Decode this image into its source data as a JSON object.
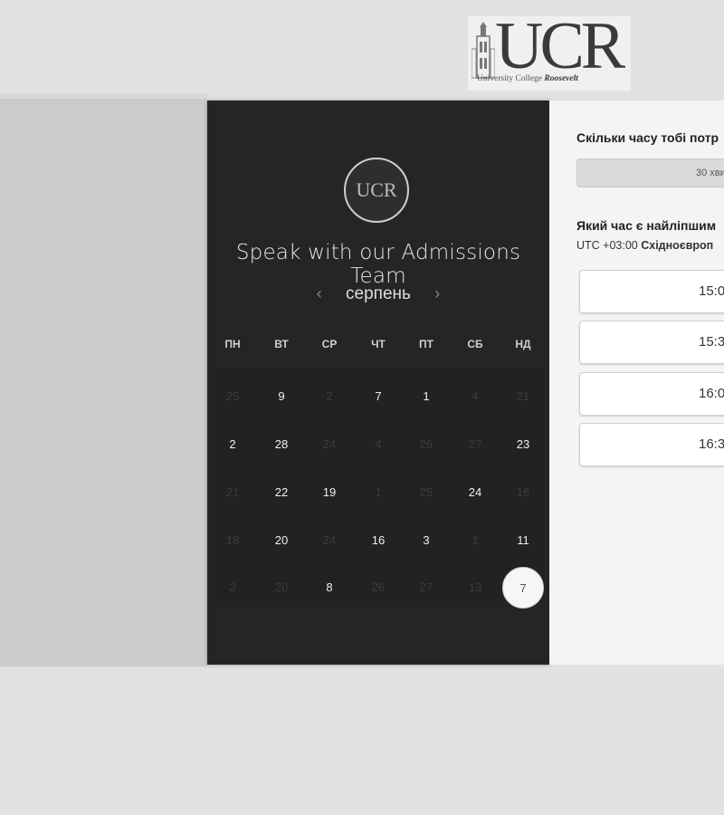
{
  "logo": {
    "letters": "UCR",
    "subtitle_prefix": "University College ",
    "subtitle_name": "Roosevelt"
  },
  "calendar": {
    "badge_text": "UCR",
    "title": "Speak with our Admissions Team",
    "month": "серпень",
    "prev_icon": "‹",
    "next_icon": "›",
    "weekdays": [
      "ПН",
      "ВТ",
      "СР",
      "ЧТ",
      "ПТ",
      "СБ",
      "НД"
    ],
    "weeks": [
      [
        {
          "d": "25",
          "a": false
        },
        {
          "d": "9",
          "a": true
        },
        {
          "d": "2",
          "a": false
        },
        {
          "d": "7",
          "a": true
        },
        {
          "d": "1",
          "a": true
        },
        {
          "d": "4",
          "a": false
        },
        {
          "d": "21",
          "a": false
        }
      ],
      [
        {
          "d": "2",
          "a": true
        },
        {
          "d": "28",
          "a": true
        },
        {
          "d": "24",
          "a": false
        },
        {
          "d": "4",
          "a": false
        },
        {
          "d": "26",
          "a": false
        },
        {
          "d": "27",
          "a": false
        },
        {
          "d": "23",
          "a": true
        }
      ],
      [
        {
          "d": "21",
          "a": false
        },
        {
          "d": "22",
          "a": true
        },
        {
          "d": "19",
          "a": true
        },
        {
          "d": "1",
          "a": false
        },
        {
          "d": "25",
          "a": false
        },
        {
          "d": "24",
          "a": true
        },
        {
          "d": "16",
          "a": false
        }
      ],
      [
        {
          "d": "18",
          "a": false
        },
        {
          "d": "20",
          "a": true
        },
        {
          "d": "24",
          "a": false
        },
        {
          "d": "16",
          "a": true
        },
        {
          "d": "3",
          "a": true
        },
        {
          "d": "1",
          "a": false
        },
        {
          "d": "11",
          "a": true
        }
      ],
      [
        {
          "d": "2",
          "a": false
        },
        {
          "d": "20",
          "a": false
        },
        {
          "d": "8",
          "a": true
        },
        {
          "d": "26",
          "a": false
        },
        {
          "d": "27",
          "a": false
        },
        {
          "d": "13",
          "a": false
        },
        {
          "d": "7",
          "a": true,
          "selected": true
        }
      ]
    ]
  },
  "form": {
    "duration_question": "Скільки часу тобі потр",
    "duration_value": "30 хви",
    "time_question": "Який час є найліпшим",
    "timezone_offset": "UTC +03:00",
    "timezone_name": "Східноєвроп",
    "slots": [
      "15:0",
      "15:3",
      "16:0",
      "16:3"
    ]
  }
}
